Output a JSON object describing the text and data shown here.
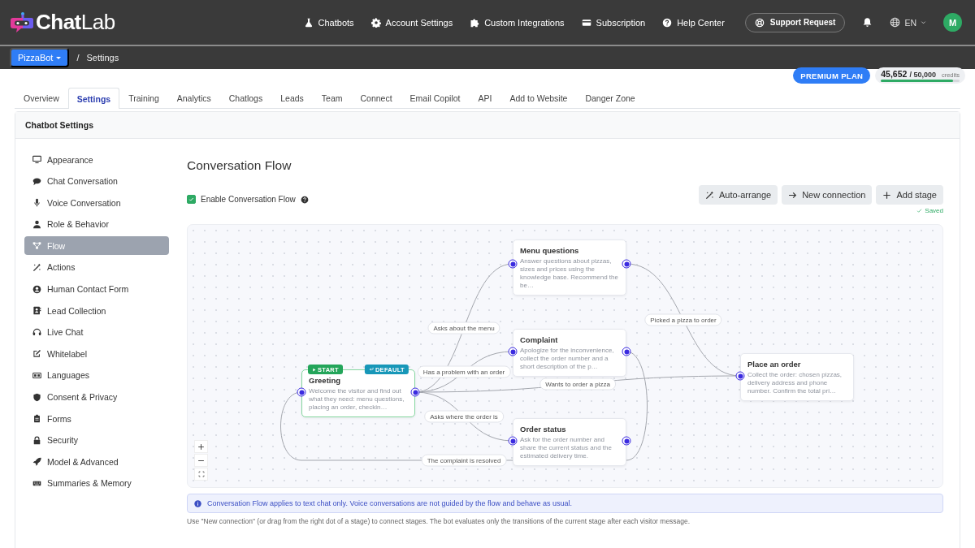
{
  "header": {
    "logo_bold": "Chat",
    "logo_light": "Lab",
    "nav": [
      {
        "label": "Chatbots"
      },
      {
        "label": "Account Settings"
      },
      {
        "label": "Custom Integrations"
      },
      {
        "label": "Subscription"
      },
      {
        "label": "Help Center"
      }
    ],
    "support": "Support Request",
    "language": "EN",
    "avatar": "M"
  },
  "breadcrumb": {
    "bot": "PizzaBot",
    "separator": "/",
    "page": "Settings"
  },
  "plan": {
    "badge": "PREMIUM PLAN",
    "used": "45,652",
    "total": "/ 50,000",
    "unit": "credits",
    "level": 0.913
  },
  "tabs": [
    {
      "label": "Overview",
      "selected": false
    },
    {
      "label": "Settings",
      "selected": true
    },
    {
      "label": "Training",
      "selected": false
    },
    {
      "label": "Analytics",
      "selected": false
    },
    {
      "label": "Chatlogs",
      "selected": false
    },
    {
      "label": "Leads",
      "selected": false
    },
    {
      "label": "Team",
      "selected": false
    },
    {
      "label": "Connect",
      "selected": false
    },
    {
      "label": "Email Copilot",
      "selected": false
    },
    {
      "label": "API",
      "selected": false
    },
    {
      "label": "Add to Website",
      "selected": false
    },
    {
      "label": "Danger Zone",
      "selected": false
    }
  ],
  "card_title": "Chatbot Settings",
  "sidebar": {
    "items": [
      {
        "label": "Appearance",
        "selected": false
      },
      {
        "label": "Chat Conversation",
        "selected": false
      },
      {
        "label": "Voice Conversation",
        "selected": false
      },
      {
        "label": "Role & Behavior",
        "selected": false
      },
      {
        "label": "Flow",
        "selected": true
      },
      {
        "label": "Actions",
        "selected": false
      },
      {
        "label": "Human Contact Form",
        "selected": false
      },
      {
        "label": "Lead Collection",
        "selected": false
      },
      {
        "label": "Live Chat",
        "selected": false
      },
      {
        "label": "Whitelabel",
        "selected": false
      },
      {
        "label": "Languages",
        "selected": false
      },
      {
        "label": "Consent & Privacy",
        "selected": false
      },
      {
        "label": "Forms",
        "selected": false
      },
      {
        "label": "Security",
        "selected": false
      },
      {
        "label": "Model & Advanced",
        "selected": false
      },
      {
        "label": "Summaries & Memory",
        "selected": false
      }
    ]
  },
  "flow": {
    "title": "Conversation Flow",
    "enable": {
      "label": "Enable Conversation Flow",
      "checked": true
    },
    "buttons": [
      {
        "label": "Auto-arrange"
      },
      {
        "label": "New connection"
      },
      {
        "label": "Add stage"
      }
    ],
    "status": "Saved",
    "stages": [
      {
        "title": "Greeting",
        "description": "Welcome the visitor and find out what they need: menu questions, placing an order, checkin…",
        "badges": [
          {
            "kind": "start",
            "label": "START"
          },
          {
            "kind": "default",
            "label": "DEFAULT"
          }
        ]
      },
      {
        "title": "Menu questions",
        "description": "Answer questions about pizzas, sizes and prices using the knowledge base. Recommend the be…"
      },
      {
        "title": "Complaint",
        "description": "Apologize for the inconvenience, collect the order number and a short description of the p…"
      },
      {
        "title": "Order status",
        "description": "Ask for the order number and share the current status and the estimated delivery time."
      },
      {
        "title": "Place an order",
        "description": "Collect the order: chosen pizzas, delivery address and phone number. Confirm the total pri…"
      }
    ],
    "transitions": [
      {
        "label": "Asks about the menu"
      },
      {
        "label": "Has a problem with an order"
      },
      {
        "label": "Wants to order a pizza"
      },
      {
        "label": "Asks where the order is"
      },
      {
        "label": "Picked a pizza to order"
      },
      {
        "label": "The complaint is resolved"
      }
    ],
    "info": "Conversation Flow applies to text chat only. Voice conversations are not guided by the flow and behave as usual.",
    "footnote": "Use \"New connection\" (or drag from the right dot of a stage) to connect stages. The bot evaluates only the transitions of the current stage after each visitor message."
  }
}
